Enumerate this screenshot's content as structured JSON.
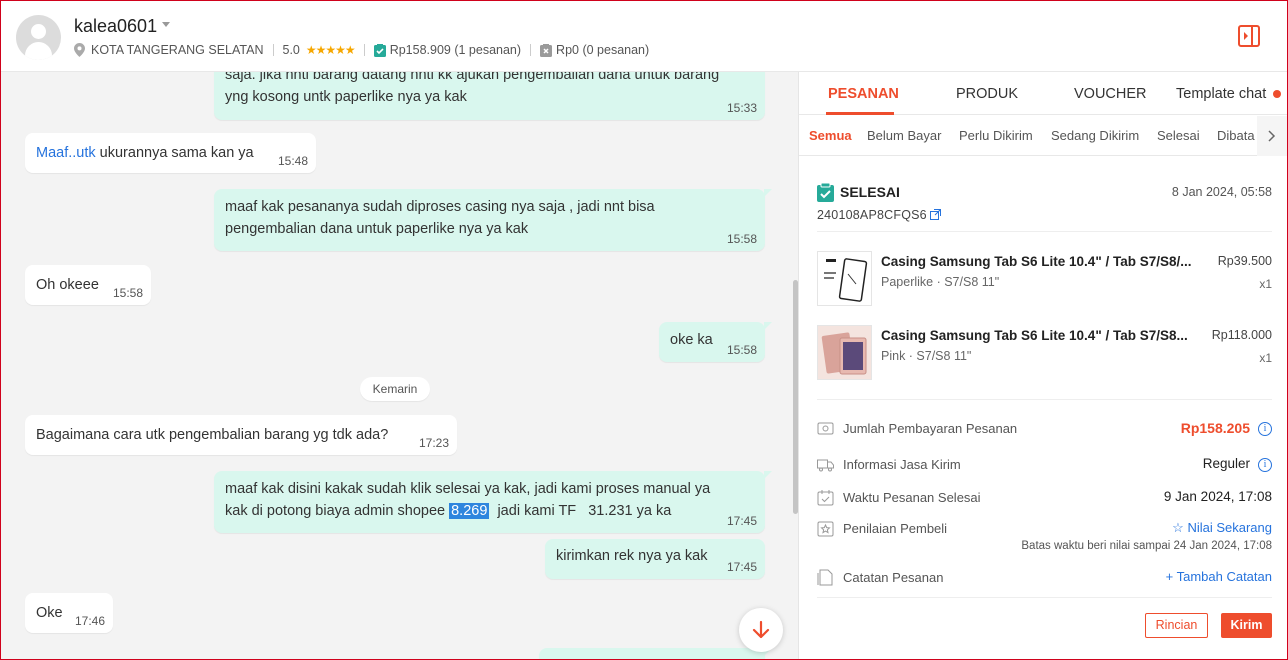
{
  "header": {
    "username": "kalea0601",
    "location": "KOTA TANGERANG SELATAN",
    "rating": "5.0",
    "stars": "★★★★★",
    "paid_amount": "Rp158.909 (1 pesanan)",
    "unpaid_amount": "Rp0 (0 pesanan)"
  },
  "chat": {
    "date_separator": "Kemarin",
    "messages": [
      {
        "side": "out",
        "line1": "saja. jika nnti barang datang nnti kk ajukan pengembalian dana untuk barang",
        "line2": "yng kosong untk paperlike nya ya kak",
        "time": "15:33"
      },
      {
        "side": "in",
        "link": "Maaf..utk",
        "text": " ukurannya sama kan ya",
        "time": "15:48"
      },
      {
        "side": "out",
        "line1": "maaf kak pesananya sudah diproses casing nya saja , jadi nnt bisa",
        "line2": "pengembalian dana untuk paperlike nya ya kak",
        "time": "15:58"
      },
      {
        "side": "in",
        "text": "Oh okeee",
        "time": "15:58"
      },
      {
        "side": "out",
        "text": "oke ka",
        "time": "15:58"
      },
      {
        "side": "in",
        "text": "Bagaimana cara utk pengembalian barang yg tdk ada?",
        "time": "17:23"
      },
      {
        "side": "out",
        "line1": "maaf kak disini kakak sudah klik selesai ya kak, jadi kami proses manual ya",
        "line2_a": "kak di potong biaya admin shopee ",
        "highlight": "8.269",
        "line2_b": "  jadi kami TF   31.231 ya ka",
        "time": "17:45"
      },
      {
        "side": "out",
        "text": "kirimkan rek nya ya kak",
        "time": "17:45"
      },
      {
        "side": "in",
        "text": "Oke",
        "time": "17:46"
      }
    ]
  },
  "panel": {
    "tabs": [
      "PESANAN",
      "PRODUK",
      "VOUCHER",
      "Template chat"
    ],
    "subtabs": [
      "Semua",
      "Belum Bayar",
      "Perlu Dikirim",
      "Sedang Dikirim",
      "Selesai",
      "Dibata"
    ],
    "order": {
      "status": "SELESAI",
      "date": "8 Jan 2024, 05:58",
      "id": "240108AP8CFQS6",
      "items": [
        {
          "name": "Casing Samsung Tab S6 Lite 10.4\" / Tab S7/S8/...",
          "variant": "Paperlike · S7/S8 11\"",
          "price": "Rp39.500",
          "qty": "x1"
        },
        {
          "name": "Casing Samsung Tab S6 Lite 10.4\" / Tab S7/S8...",
          "variant": "Pink · S7/S8 11\"",
          "price": "Rp118.000",
          "qty": "x1"
        }
      ],
      "info": {
        "payment_label": "Jumlah Pembayaran Pesanan",
        "payment_value": "Rp158.205",
        "shipping_label": "Informasi Jasa Kirim",
        "shipping_value": "Reguler",
        "completed_label": "Waktu Pesanan Selesai",
        "completed_value": "9 Jan 2024, 17:08",
        "rating_label": "Penilaian Pembeli",
        "rating_value": "Nilai Sekarang",
        "rating_deadline": "Batas waktu beri nilai sampai 24 Jan 2024, 17:08",
        "notes_label": "Catatan Pesanan",
        "notes_value": "Tambah Catatan"
      },
      "buttons": {
        "detail": "Rincian",
        "send": "Kirim"
      }
    }
  },
  "colors": {
    "accent": "#ee4d2d",
    "link": "#2673dd",
    "outgoing_bubble": "#d9f7ee",
    "star": "#f6a700"
  }
}
